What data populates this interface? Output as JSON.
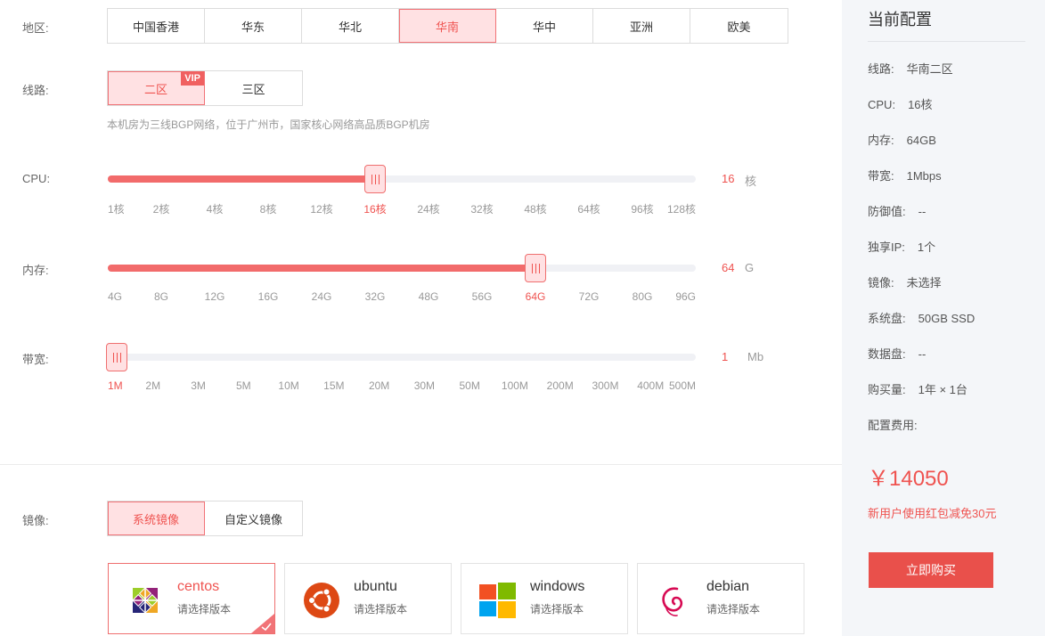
{
  "region": {
    "label": "地区:",
    "options": [
      "中国香港",
      "华东",
      "华北",
      "华南",
      "华中",
      "亚洲",
      "欧美"
    ],
    "selected": "华南"
  },
  "line": {
    "label": "线路:",
    "options": [
      "二区",
      "三区"
    ],
    "selected": "二区",
    "vip_badge": "VIP",
    "note": "本机房为三线BGP网络，位于广州市，国家核心网络高品质BGP机房"
  },
  "cpu": {
    "label": "CPU:",
    "ticks": [
      "1核",
      "2核",
      "4核",
      "8核",
      "12核",
      "16核",
      "24核",
      "32核",
      "48核",
      "64核",
      "96核",
      "128核"
    ],
    "selected_index": 5,
    "value": "16",
    "unit": "核"
  },
  "memory": {
    "label": "内存:",
    "ticks": [
      "4G",
      "8G",
      "12G",
      "16G",
      "24G",
      "32G",
      "48G",
      "56G",
      "64G",
      "72G",
      "80G",
      "96G"
    ],
    "selected_index": 8,
    "value": "64",
    "unit": "G"
  },
  "bandwidth": {
    "label": "带宽:",
    "ticks": [
      "1M",
      "2M",
      "3M",
      "5M",
      "10M",
      "15M",
      "20M",
      "30M",
      "50M",
      "100M",
      "200M",
      "300M",
      "400M",
      "500M"
    ],
    "selected_index": 0,
    "value": "1",
    "unit": "Mb"
  },
  "image": {
    "label": "镜像:",
    "tabs": [
      "系统镜像",
      "自定义镜像"
    ],
    "selected_tab": "系统镜像",
    "os": [
      {
        "name": "centos",
        "sub": "请选择版本",
        "icon": "centos-logo-icon"
      },
      {
        "name": "ubuntu",
        "sub": "请选择版本",
        "icon": "ubuntu-logo-icon"
      },
      {
        "name": "windows",
        "sub": "请选择版本",
        "icon": "windows-logo-icon"
      },
      {
        "name": "debian",
        "sub": "请选择版本",
        "icon": "debian-logo-icon"
      }
    ],
    "selected_os": "centos"
  },
  "summary": {
    "title": "当前配置",
    "specs": [
      {
        "k": "线路:",
        "v": "华南二区"
      },
      {
        "k": "CPU:",
        "v": "16核"
      },
      {
        "k": "内存:",
        "v": "64GB"
      },
      {
        "k": "带宽:",
        "v": "1Mbps"
      },
      {
        "k": "防御值:",
        "v": "--"
      },
      {
        "k": "独享IP:",
        "v": "1个"
      },
      {
        "k": "镜像:",
        "v": "未选择"
      },
      {
        "k": "系统盘:",
        "v": "50GB SSD"
      },
      {
        "k": "数据盘:",
        "v": "--"
      },
      {
        "k": "购买量:",
        "v": "1年 × 1台"
      },
      {
        "k": "配置费用:",
        "v": ""
      }
    ],
    "price": "￥14050",
    "promo": "新用户使用红包减免30元",
    "buy_label": "立即购买"
  },
  "colors": {
    "accent": "#ef5350",
    "active_bg": "#ffe1e3",
    "slider_fill": "#f26b6b",
    "sidebar_bg": "#f4f6f9"
  }
}
